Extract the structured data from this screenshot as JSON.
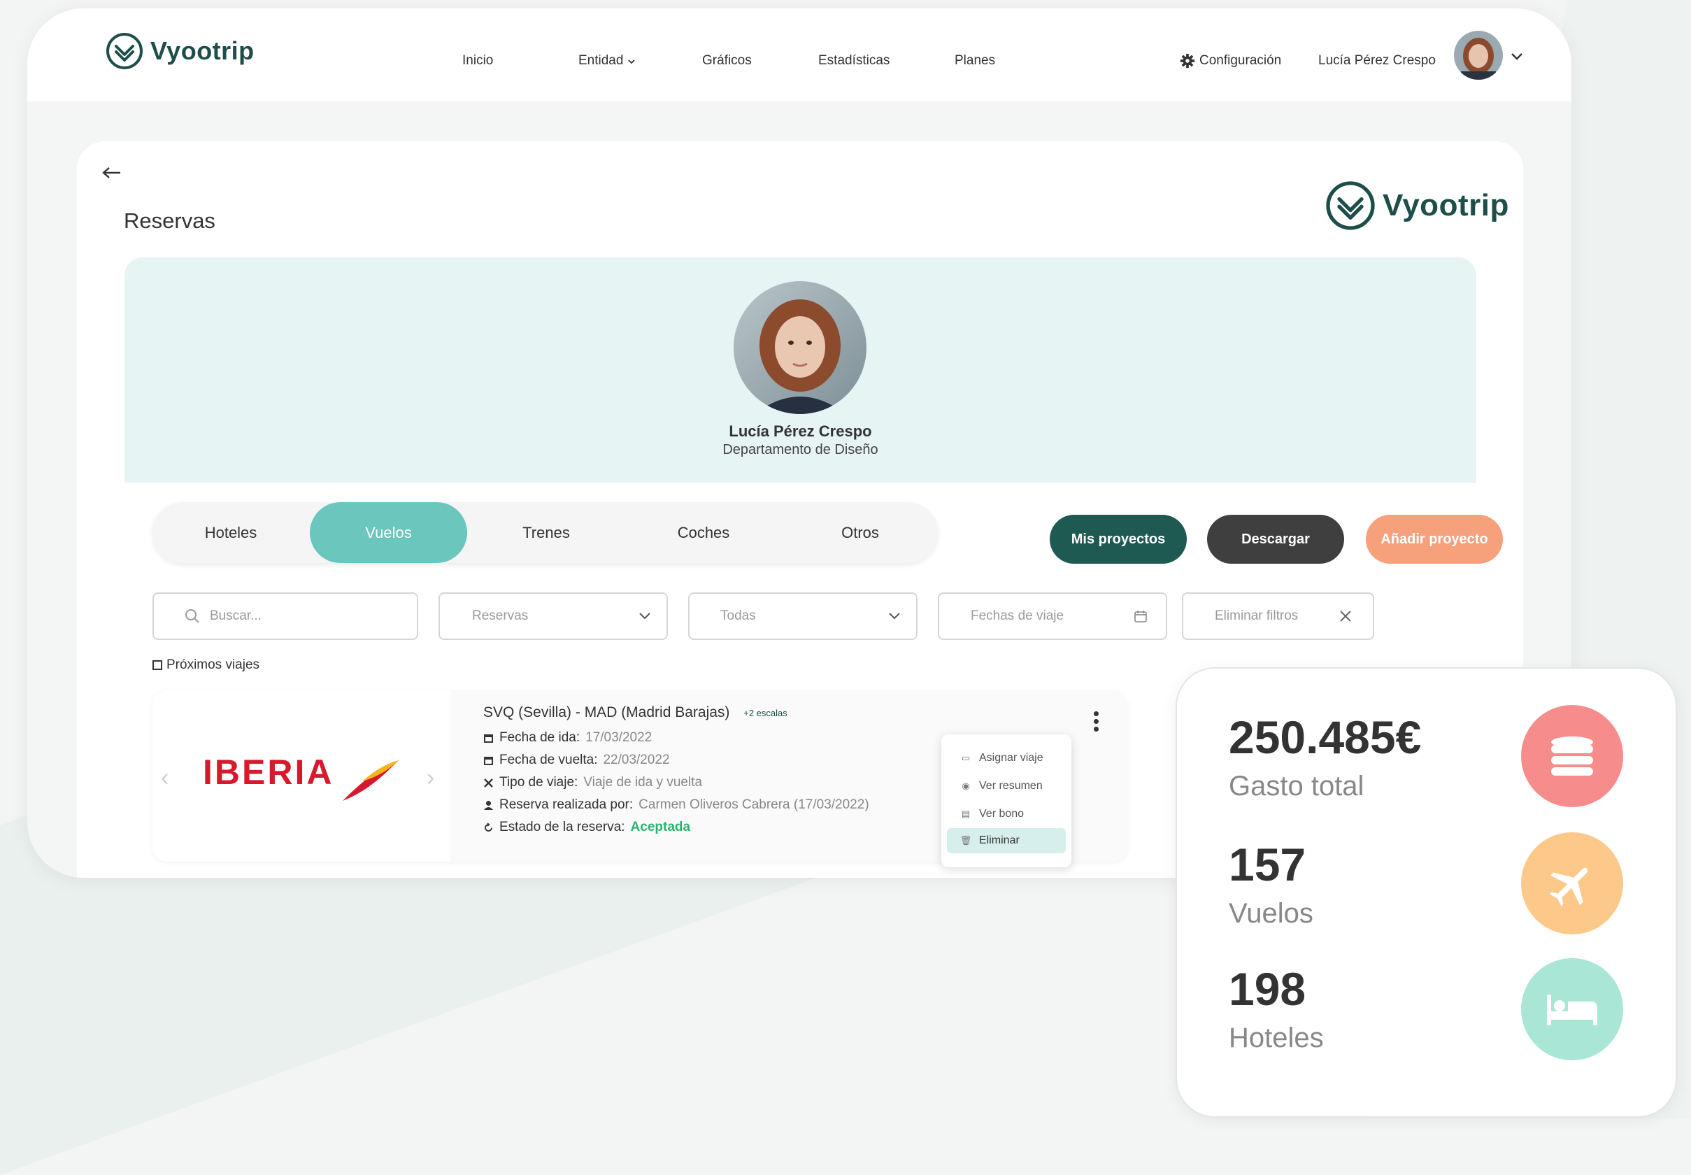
{
  "brand": {
    "name": "Vyootrip",
    "color": "#1e4e4a"
  },
  "nav": {
    "items": [
      "Inicio",
      "Entidad",
      "Gráficos",
      "Estadísticas",
      "Planes"
    ],
    "settings_label": "Configuración",
    "user_name": "Lucía Pérez Crespo"
  },
  "page": {
    "title": "Reservas"
  },
  "profile": {
    "name": "Lucía Pérez Crespo",
    "department": "Departamento de Diseño"
  },
  "tabs": {
    "items": [
      "Hoteles",
      "Vuelos",
      "Trenes",
      "Coches",
      "Otros"
    ],
    "active": "Vuelos"
  },
  "actions": {
    "projects": {
      "label": "Mis proyectos",
      "color": "#1e5a52"
    },
    "download": {
      "label": "Descargar",
      "color": "#3f3f3f"
    },
    "add_project": {
      "label": "Añadir proyecto",
      "color": "#f6a07c"
    }
  },
  "filters": {
    "search_placeholder": "Buscar...",
    "type_select": "Reservas",
    "status_select": "Todas",
    "dates_placeholder": "Fechas de viaje",
    "clear_label": "Eliminar filtros"
  },
  "upcoming_checkbox": {
    "label": "Próximos viajes",
    "checked": false
  },
  "booking": {
    "airline": "IBERIA",
    "route": "SVQ (Sevilla) - MAD (Madrid Barajas)",
    "stops": "+2 escalas",
    "outbound_label": "Fecha de ida:",
    "outbound_value": "17/03/2022",
    "return_label": "Fecha de vuelta:",
    "return_value": "22/03/2022",
    "trip_type_label": "Tipo de viaje:",
    "trip_type_value": "Viaje de ida y vuelta",
    "booked_by_label": "Reserva realizada por:",
    "booked_by_value": "Carmen Oliveros Cabrera (17/03/2022)",
    "status_label": "Estado de la reserva:",
    "status_value": "Aceptada",
    "status_color": "#29b56f"
  },
  "context_menu": {
    "items": [
      {
        "label": "Asignar viaje",
        "icon": "suitcase-icon"
      },
      {
        "label": "Ver resumen",
        "icon": "eye-icon"
      },
      {
        "label": "Ver bono",
        "icon": "document-icon"
      },
      {
        "label": "Eliminar",
        "icon": "trash-icon"
      }
    ],
    "highlighted": "Eliminar"
  },
  "stats": [
    {
      "value": "250.485€",
      "label": "Gasto total",
      "icon": "coins-icon",
      "color": "#f78c8c"
    },
    {
      "value": "157",
      "label": "Vuelos",
      "icon": "airplane-icon",
      "color": "#fcc98a"
    },
    {
      "value": "198",
      "label": "Hoteles",
      "icon": "bed-icon",
      "color": "#a9e6d6"
    }
  ]
}
